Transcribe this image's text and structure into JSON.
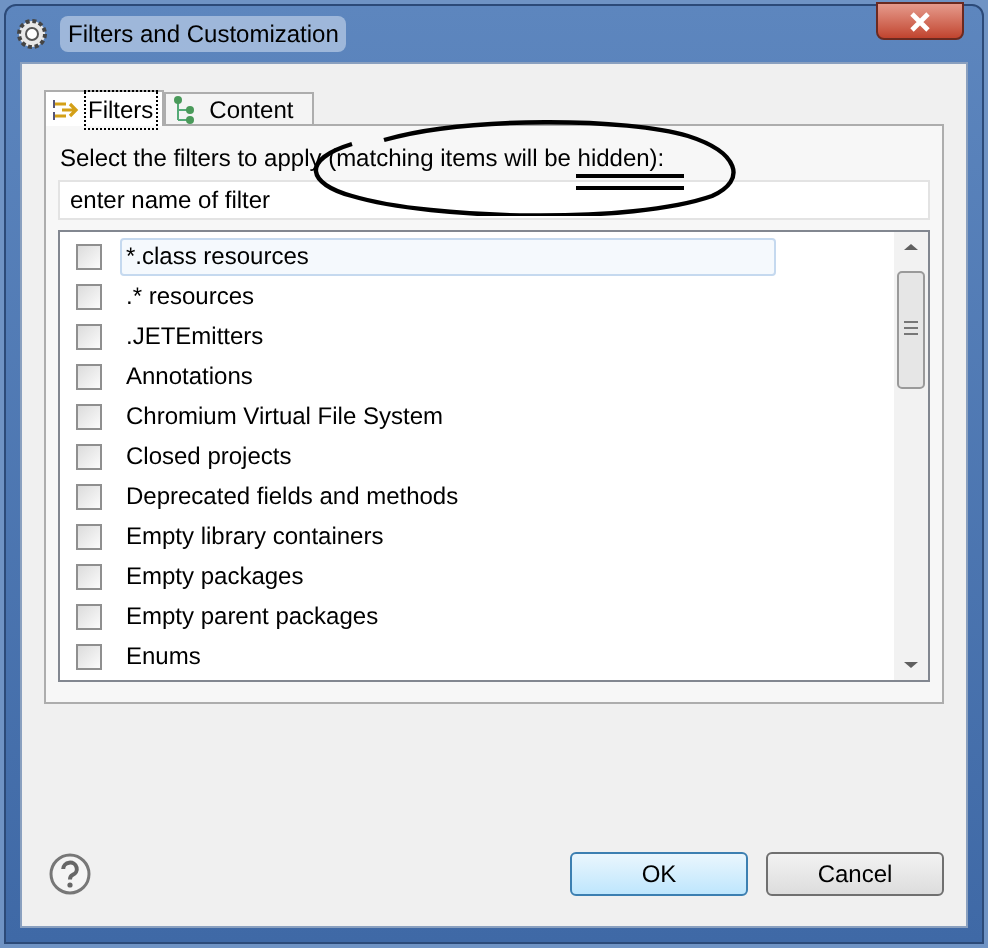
{
  "window": {
    "title": "Filters and Customization"
  },
  "tabs": [
    {
      "label": "Filters",
      "selected": true
    },
    {
      "label": "Content",
      "selected": false
    }
  ],
  "instruction": "Select the filters to apply (matching items will be hidden):",
  "search": {
    "placeholder": "enter name of filter"
  },
  "filters": [
    {
      "label": "*.class resources",
      "checked": false,
      "selected": true
    },
    {
      "label": ".* resources",
      "checked": false,
      "selected": false
    },
    {
      "label": ".JETEmitters",
      "checked": false,
      "selected": false
    },
    {
      "label": "Annotations",
      "checked": false,
      "selected": false
    },
    {
      "label": "Chromium Virtual File System",
      "checked": false,
      "selected": false
    },
    {
      "label": "Closed projects",
      "checked": false,
      "selected": false
    },
    {
      "label": "Deprecated fields and methods",
      "checked": false,
      "selected": false
    },
    {
      "label": "Empty library containers",
      "checked": false,
      "selected": false
    },
    {
      "label": "Empty packages",
      "checked": false,
      "selected": false
    },
    {
      "label": "Empty parent packages",
      "checked": false,
      "selected": false
    },
    {
      "label": "Enums",
      "checked": false,
      "selected": false
    }
  ],
  "buttons": [
    {
      "label": "OK",
      "default": true
    },
    {
      "label": "Cancel",
      "default": false
    }
  ]
}
